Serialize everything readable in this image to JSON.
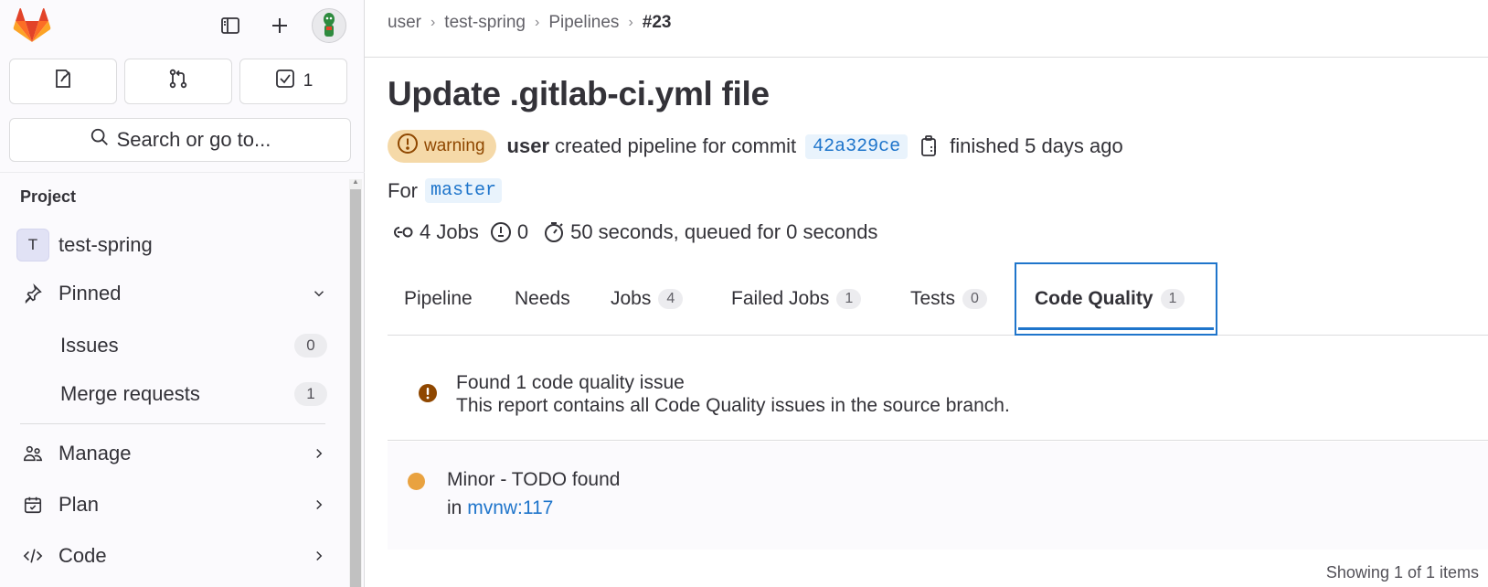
{
  "sidebar": {
    "todo_count": "1",
    "search_placeholder": "Search or go to...",
    "section_label": "Project",
    "project": {
      "initial": "T",
      "name": "test-spring"
    },
    "pinned_label": "Pinned",
    "pinned_items": [
      {
        "label": "Issues",
        "count": "0"
      },
      {
        "label": "Merge requests",
        "count": "1"
      }
    ],
    "groups": [
      {
        "label": "Manage",
        "icon": "users-icon"
      },
      {
        "label": "Plan",
        "icon": "calendar-icon"
      },
      {
        "label": "Code",
        "icon": "code-icon"
      }
    ]
  },
  "breadcrumb": {
    "items": [
      "user",
      "test-spring",
      "Pipelines"
    ],
    "current": "#23"
  },
  "pipeline": {
    "title": "Update .gitlab-ci.yml file",
    "status": "warning",
    "author": "user",
    "created_text": "created pipeline for commit",
    "commit_sha": "42a329ce",
    "finished_text": "finished 5 days ago",
    "for_label": "For",
    "branch": "master",
    "jobs_text": "4 Jobs",
    "duration_count": "0",
    "duration_text": "50 seconds, queued for 0 seconds"
  },
  "tabs": [
    {
      "label": "Pipeline",
      "count": null
    },
    {
      "label": "Needs",
      "count": null
    },
    {
      "label": "Jobs",
      "count": "4"
    },
    {
      "label": "Failed Jobs",
      "count": "1"
    },
    {
      "label": "Tests",
      "count": "0"
    },
    {
      "label": "Code Quality",
      "count": "1",
      "active": true
    }
  ],
  "code_quality": {
    "summary_title": "Found 1 code quality issue",
    "summary_sub": "This report contains all Code Quality issues in the source branch.",
    "issue": {
      "severity_title": "Minor - TODO found",
      "in_label": "in",
      "location": "mvnw:117"
    },
    "showing": "Showing 1 of 1 items"
  },
  "colors": {
    "accent": "#1f75cb",
    "warning_bg": "#f5d9a8",
    "warning_text": "#8f4700",
    "minor_dot": "#e9a240"
  }
}
